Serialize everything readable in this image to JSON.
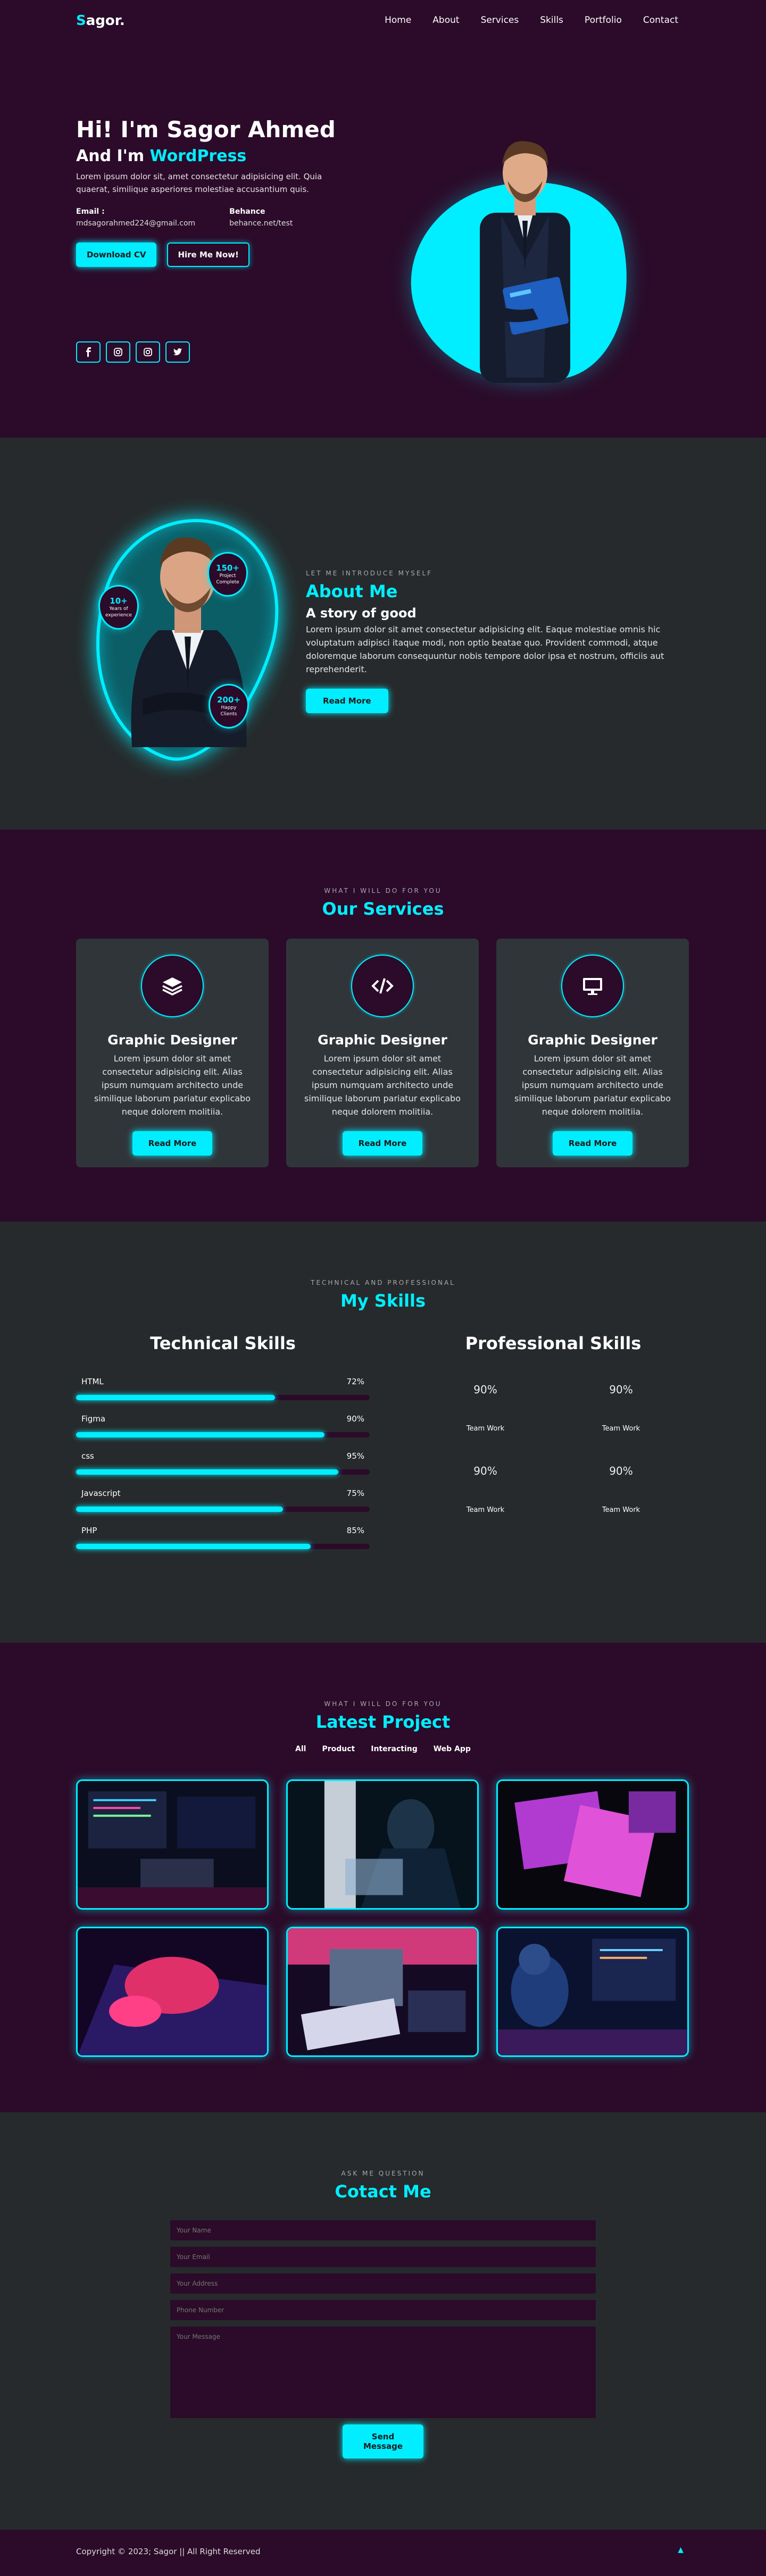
{
  "nav": {
    "logo_first": "S",
    "logo_rest": "agor.",
    "links": [
      "Home",
      "About",
      "Services",
      "Skills",
      "Portfolio",
      "Contact"
    ]
  },
  "hero": {
    "greeting": "Hi! I'm Sagor Ahmed",
    "role_prefix": "And I'm ",
    "role": "WordPress",
    "lead": "Lorem ipsum dolor sit, amet consectetur adipisicing elit. Quia quaerat, similique asperiores molestiae accusantium quis.",
    "email_label": "Email :",
    "email": "mdsagorahmed224@gmail.com",
    "behance_label": "Behance",
    "behance": "behance.net/test",
    "btn_cv": "Download CV",
    "btn_hire": "Hire Me Now!",
    "socials": [
      "facebook-icon",
      "instagram-icon",
      "instagram-icon",
      "twitter-icon"
    ]
  },
  "about": {
    "kicker": "LET ME INTRODUCE MYSELF",
    "title": "About Me",
    "subtitle": "A story of good",
    "text": "Lorem ipsum dolor sit amet consectetur adipisicing elit. Eaque molestiae omnis hic voluptatum adipisci itaque modi, non optio beatae quo. Provident commodi, atque doloremque laborum consequuntur nobis tempore dolor ipsa et nostrum, officiis aut reprehenderit.",
    "button": "Read More",
    "badges": [
      {
        "num": "150+",
        "text": "Project Complete"
      },
      {
        "num": "10+",
        "text": "Years of experience"
      },
      {
        "num": "200+",
        "text": "Happy Clients"
      }
    ]
  },
  "services": {
    "kicker": "WHAT I WILL DO FOR YOU",
    "title": "Our Services",
    "cards": [
      {
        "icon": "layers-icon",
        "title": "Graphic Designer",
        "text": "Lorem ipsum dolor sit amet consectetur adipisicing elit. Alias ipsum numquam architecto unde similique laborum pariatur explicabo neque dolorem molitiia.",
        "button": "Read More"
      },
      {
        "icon": "code-icon",
        "title": "Graphic Designer",
        "text": "Lorem ipsum dolor sit amet consectetur adipisicing elit. Alias ipsum numquam architecto unde similique laborum pariatur explicabo neque dolorem molitiia.",
        "button": "Read More"
      },
      {
        "icon": "desktop-icon",
        "title": "Graphic Designer",
        "text": "Lorem ipsum dolor sit amet consectetur adipisicing elit. Alias ipsum numquam architecto unde similique laborum pariatur explicabo neque dolorem molitiia.",
        "button": "Read More"
      }
    ]
  },
  "skills": {
    "kicker": "TECHNICAL AND PROFESSIONAL",
    "title": "My Skills",
    "tech_title": "Technical Skills",
    "prof_title": "Professional Skills",
    "tech": [
      {
        "name": "HTML",
        "pct_label": "72%",
        "pct": 72
      },
      {
        "name": "Figma",
        "pct_label": "90%",
        "pct": 90
      },
      {
        "name": "css",
        "pct_label": "95%",
        "pct": 95
      },
      {
        "name": "Javascript",
        "pct_label": "75%",
        "pct": 75
      },
      {
        "name": "PHP",
        "pct_label": "85%",
        "pct": 85
      }
    ],
    "prof": [
      {
        "pct": "90%",
        "label": "Team Work"
      },
      {
        "pct": "90%",
        "label": "Team Work"
      },
      {
        "pct": "90%",
        "label": "Team Work"
      },
      {
        "pct": "90%",
        "label": "Team Work"
      }
    ]
  },
  "projects": {
    "kicker": "WHAT I WILL DO FOR YOU",
    "title": "Latest Project",
    "filters": [
      "All",
      "Product",
      "Interacting",
      "Web App"
    ]
  },
  "contact": {
    "kicker": "ASK ME QUESTION",
    "title": "Cotact Me",
    "name_ph": "Your Name",
    "email_ph": "Your Email",
    "address_ph": "Your Address",
    "phone_ph": "Phone Number",
    "message_ph": "Your Message",
    "button": "Send Message"
  },
  "footer": {
    "copyright": "Copyright © 2023; Sagor || All Right Reserved"
  },
  "colors": {
    "accent": "#00eeff",
    "plum": "#2b0b29",
    "dark": "#262a2c",
    "card": "#30353a"
  }
}
